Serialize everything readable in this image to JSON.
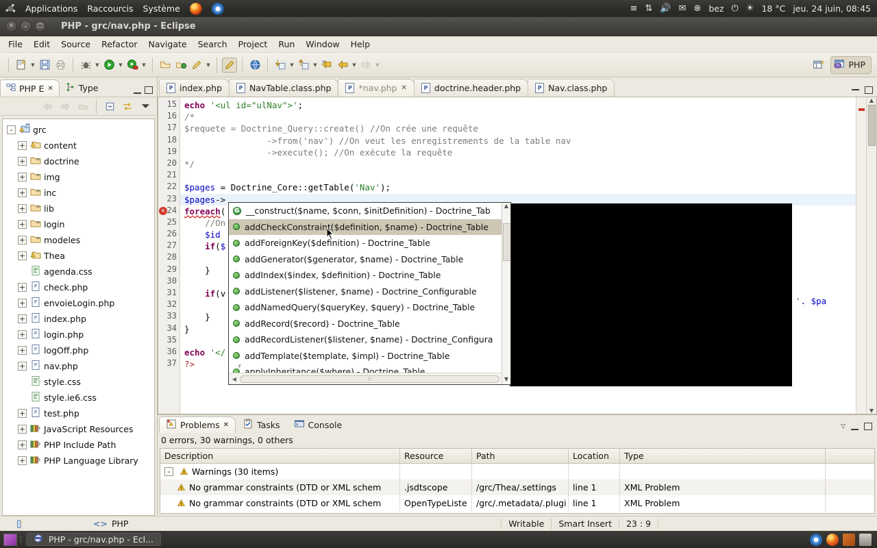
{
  "gnome_panel": {
    "logo": "ubuntu-logo",
    "menus": [
      "Applications",
      "Raccourcis",
      "Système"
    ],
    "launchers": [
      "firefox-icon",
      "chrome-icon"
    ],
    "indicators": {
      "network": "network-up-down-icon",
      "volume": "volume-icon",
      "mail": "mail-icon",
      "user": "bez",
      "power": "power-icon",
      "weather_icon": "sun-icon",
      "temperature": "18 °C",
      "datetime": "jeu. 24 juin, 08:45"
    }
  },
  "window": {
    "title": "PHP - grc/nav.php - Eclipse",
    "buttons": {
      "close": "×",
      "minimize": "⌄",
      "maximize": "□"
    }
  },
  "menubar": [
    "File",
    "Edit",
    "Source",
    "Refactor",
    "Navigate",
    "Search",
    "Project",
    "Run",
    "Window",
    "Help"
  ],
  "toolbar": {
    "groups": [
      [
        "new-wizard-icon",
        "save-icon",
        "print-icon"
      ],
      [
        "debug-icon",
        "run-icon",
        "run-external-icon"
      ],
      [
        "open-type-icon",
        "open-resource-icon",
        "edit-icon"
      ],
      [
        "toggle-mark-occurrences-icon"
      ],
      [
        "open-web-browser-icon"
      ],
      [
        "next-annotation-icon",
        "previous-annotation-icon",
        "last-edit-location-icon",
        "back-icon",
        "forward-icon"
      ]
    ],
    "perspective": {
      "open_perspective_icon": "open-perspective-icon",
      "current": "PHP",
      "icon": "php-perspective-icon"
    }
  },
  "explorer": {
    "tabs": [
      {
        "label": "PHP E",
        "icon": "php-explorer-icon",
        "selected": true,
        "closable": true
      },
      {
        "label": "Type",
        "icon": "type-hierarchy-icon",
        "selected": false,
        "closable": false
      }
    ],
    "view_buttons": [
      "minimize-icon",
      "maximize-icon"
    ],
    "toolbar_icons": [
      "back-icon",
      "forward-icon",
      "up-icon",
      "collapse-all-icon",
      "link-with-editor-icon",
      "view-menu-icon"
    ],
    "tree": [
      {
        "indent": 0,
        "twisty": "-",
        "icon": "php-project-icon",
        "label": "grc"
      },
      {
        "indent": 1,
        "twisty": "+",
        "icon": "folder-warning-icon",
        "label": "content"
      },
      {
        "indent": 1,
        "twisty": "+",
        "icon": "folder-icon",
        "label": "doctrine"
      },
      {
        "indent": 1,
        "twisty": "+",
        "icon": "folder-icon",
        "label": "img"
      },
      {
        "indent": 1,
        "twisty": "+",
        "icon": "folder-icon",
        "label": "inc"
      },
      {
        "indent": 1,
        "twisty": "+",
        "icon": "folder-icon",
        "label": "lib"
      },
      {
        "indent": 1,
        "twisty": "+",
        "icon": "folder-icon",
        "label": "login"
      },
      {
        "indent": 1,
        "twisty": "+",
        "icon": "folder-icon",
        "label": "modeles"
      },
      {
        "indent": 1,
        "twisty": "+",
        "icon": "folder-warning-icon",
        "label": "Thea"
      },
      {
        "indent": 1,
        "twisty": "",
        "icon": "css-file-icon",
        "label": "agenda.css"
      },
      {
        "indent": 1,
        "twisty": "+",
        "icon": "php-file-icon",
        "label": "check.php"
      },
      {
        "indent": 1,
        "twisty": "+",
        "icon": "php-file-icon",
        "label": "envoieLogin.php"
      },
      {
        "indent": 1,
        "twisty": "+",
        "icon": "php-file-icon",
        "label": "index.php"
      },
      {
        "indent": 1,
        "twisty": "+",
        "icon": "php-file-icon",
        "label": "login.php"
      },
      {
        "indent": 1,
        "twisty": "+",
        "icon": "php-file-icon",
        "label": "logOff.php"
      },
      {
        "indent": 1,
        "twisty": "+",
        "icon": "php-file-icon",
        "label": "nav.php"
      },
      {
        "indent": 1,
        "twisty": "",
        "icon": "css-file-icon",
        "label": "style.css"
      },
      {
        "indent": 1,
        "twisty": "",
        "icon": "css-file-icon",
        "label": "style.ie6.css"
      },
      {
        "indent": 1,
        "twisty": "+",
        "icon": "php-file-icon",
        "label": "test.php"
      },
      {
        "indent": 1,
        "twisty": "+",
        "icon": "library-icon",
        "label": "JavaScript Resources"
      },
      {
        "indent": 1,
        "twisty": "+",
        "icon": "library-icon",
        "label": "PHP Include Path"
      },
      {
        "indent": 1,
        "twisty": "+",
        "icon": "library-icon",
        "label": "PHP Language Library"
      }
    ]
  },
  "editor": {
    "tabs": [
      {
        "label": "index.php",
        "selected": false,
        "dirty": false,
        "closable": false
      },
      {
        "label": "NavTable.class.php",
        "selected": false,
        "dirty": false,
        "closable": false
      },
      {
        "label": "*nav.php",
        "selected": true,
        "dirty": true,
        "closable": true
      },
      {
        "label": "doctrine.header.php",
        "selected": false,
        "dirty": false,
        "closable": false
      },
      {
        "label": "Nav.class.php",
        "selected": false,
        "dirty": false,
        "closable": false
      }
    ],
    "view_buttons": [
      "minimize-icon",
      "maximize-icon"
    ],
    "first_line_number": 15,
    "current_line": 23,
    "error_line": 24,
    "lines": [
      {
        "n": 15,
        "html": "<span class=\"kw\">echo</span> <span class=\"str\">'&lt;ul id=\"ulNav\"&gt;'</span>;"
      },
      {
        "n": 16,
        "html": "<span class=\"cm\">/*</span>"
      },
      {
        "n": 17,
        "html": "<span class=\"cm\">$requete = Doctrine_Query::create() //On crée une requête</span>"
      },
      {
        "n": 18,
        "html": "<span class=\"cm\">                -&gt;from('nav') //On veut les enregistrements de la table nav</span>"
      },
      {
        "n": 19,
        "html": "<span class=\"cm\">                -&gt;execute(); //On exécute la requête</span>"
      },
      {
        "n": 20,
        "html": "<span class=\"cm\">*/</span>"
      },
      {
        "n": 21,
        "html": ""
      },
      {
        "n": 22,
        "html": "<span class=\"var\">$pages</span> = Doctrine_Core::getTable(<span class=\"str\">'Nav'</span>);"
      },
      {
        "n": 23,
        "html": "<span class=\"var\">$pages</span>-&gt;"
      },
      {
        "n": 24,
        "html": "<span class=\"kw err-underline\">foreach</span>("
      },
      {
        "n": 25,
        "html": "    <span class=\"cm\">//On</span>"
      },
      {
        "n": 26,
        "html": "    <span class=\"var\">$id</span>"
      },
      {
        "n": 27,
        "html": "    <span class=\"kw\">if</span>(<span class=\"var\">$</span>"
      },
      {
        "n": 28,
        "html": ""
      },
      {
        "n": 29,
        "html": "    }"
      },
      {
        "n": 30,
        "html": ""
      },
      {
        "n": 31,
        "html": "    <span class=\"kw\">if</span>(v"
      },
      {
        "n": 32,
        "html": ""
      },
      {
        "n": 33,
        "html": "    }"
      },
      {
        "n": 34,
        "html": "}"
      },
      {
        "n": 35,
        "html": ""
      },
      {
        "n": 36,
        "html": "<span class=\"kw\">echo</span> <span class=\"str\">'&lt;/</span>"
      },
      {
        "n": 37,
        "html": "<span class=\"tag\">?&gt;</span>"
      }
    ],
    "right_fragment": ". $pa",
    "right_fragment_quote": "'"
  },
  "autocomplete": {
    "selected_index": 1,
    "items": [
      {
        "icon": "constructor-icon",
        "label": "__construct($name, $conn, $initDefinition) - Doctrine_Tab"
      },
      {
        "icon": "method-icon",
        "label": "addCheckConstraint($definition, $name) - Doctrine_Table"
      },
      {
        "icon": "method-icon",
        "label": "addForeignKey($definition) - Doctrine_Table"
      },
      {
        "icon": "method-icon",
        "label": "addGenerator($generator, $name) - Doctrine_Table"
      },
      {
        "icon": "method-icon",
        "label": "addIndex($index, $definition) - Doctrine_Table"
      },
      {
        "icon": "method-icon",
        "label": "addListener($listener, $name) - Doctrine_Configurable"
      },
      {
        "icon": "method-icon",
        "label": "addNamedQuery($queryKey, $query) - Doctrine_Table"
      },
      {
        "icon": "method-icon",
        "label": "addRecord($record) - Doctrine_Table"
      },
      {
        "icon": "method-icon",
        "label": "addRecordListener($listener, $name) - Doctrine_Configura"
      },
      {
        "icon": "method-icon",
        "label": "addTemplate($template, $impl) - Doctrine_Table"
      },
      {
        "icon": "final-method-icon",
        "label": "applyInheritance($where) - Doctrine_Table"
      }
    ]
  },
  "problems_view": {
    "tabs": [
      {
        "label": "Problems",
        "icon": "problems-icon",
        "selected": true,
        "closable": true
      },
      {
        "label": "Tasks",
        "icon": "tasks-icon",
        "selected": false,
        "closable": false
      },
      {
        "label": "Console",
        "icon": "console-icon",
        "selected": false,
        "closable": false
      }
    ],
    "view_buttons": [
      "view-menu-icon",
      "minimize-icon",
      "maximize-icon"
    ],
    "summary": "0 errors, 30 warnings, 0 others",
    "columns": [
      "Description",
      "Resource",
      "Path",
      "Location",
      "Type"
    ],
    "rows": [
      {
        "type": "group",
        "twisty": "-",
        "icon": "warning-icon",
        "description": "Warnings (30 items)",
        "resource": "",
        "path": "",
        "location": "",
        "kind": ""
      },
      {
        "type": "item",
        "icon": "warning-icon",
        "description": "No grammar constraints (DTD or XML schem",
        "resource": ".jsdtscope",
        "path": "/grc/Thea/.settings",
        "location": "line 1",
        "kind": "XML Problem"
      },
      {
        "type": "item",
        "icon": "warning-icon",
        "description": "No grammar constraints (DTD or XML schem",
        "resource": "OpenTypeListe",
        "path": "/grc/.metadata/.plugi",
        "location": "line 1",
        "kind": "XML Problem"
      }
    ]
  },
  "statusbar": {
    "left_icon": "smart-insert-indicator-icon",
    "language_icon": "code-icon",
    "language": "PHP",
    "writable": "Writable",
    "insert_mode": "Smart Insert",
    "position": "23 : 9"
  },
  "taskbar": {
    "show_desktop_icon": "show-desktop-icon",
    "task_label": "PHP - grc/nav.php - Ecl...",
    "task_icon": "eclipse-icon",
    "tray_icons": [
      "chrome-tray-icon",
      "firefox-tray-icon",
      "workspace-tray-icon",
      "trash-tray-icon"
    ]
  },
  "colors": {
    "accent": "#cdc7b4",
    "panel_bg": "#ece9e0",
    "gnome_bg": "#2e2d2a",
    "error": "#d03a2c",
    "warning": "#e8a33d"
  }
}
